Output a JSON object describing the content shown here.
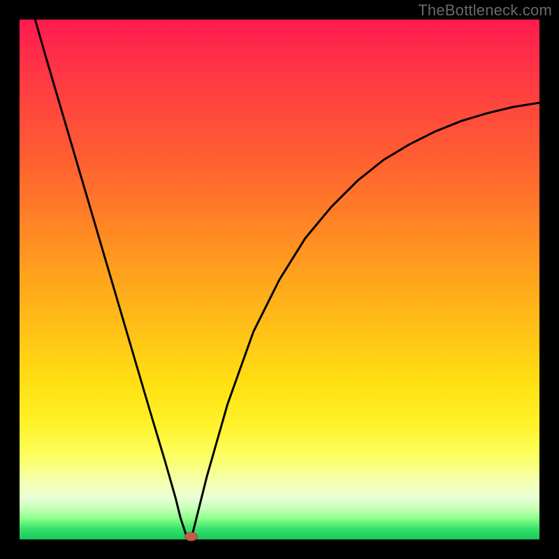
{
  "watermark": "TheBottleneck.com",
  "chart_data": {
    "type": "line",
    "title": "",
    "xlabel": "",
    "ylabel": "",
    "xlim": [
      0,
      100
    ],
    "ylim": [
      0,
      100
    ],
    "grid": false,
    "legend": false,
    "series": [
      {
        "name": "curve",
        "x": [
          3,
          5,
          10,
          15,
          20,
          25,
          28,
          30,
          31,
          32,
          33,
          34,
          36,
          40,
          45,
          50,
          55,
          60,
          65,
          70,
          75,
          80,
          85,
          90,
          95,
          100
        ],
        "values": [
          100,
          93,
          76,
          59,
          42,
          25,
          15,
          8,
          4,
          1,
          0,
          4,
          12,
          26,
          40,
          50,
          58,
          64,
          69,
          73,
          76,
          78.5,
          80.5,
          82,
          83.2,
          84
        ]
      }
    ],
    "min_point": {
      "x": 33,
      "y": 0
    }
  },
  "colors": {
    "curve_stroke": "#000000",
    "marker_fill": "#c75a47",
    "background_black": "#000000"
  }
}
